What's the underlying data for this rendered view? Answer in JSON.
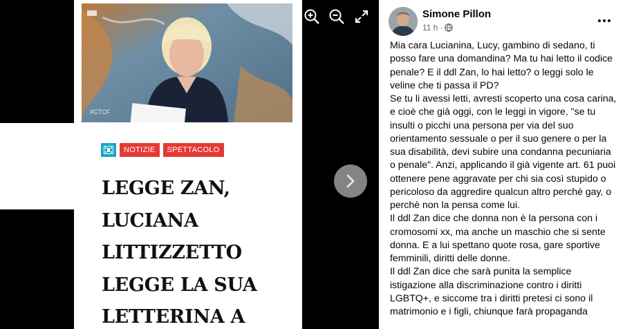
{
  "viewer": {
    "photo_watermark": "#CTCF",
    "tags": [
      "NOTIZIE",
      "SPETTACOLO"
    ],
    "headline_lines": [
      "LEGGE ZAN,",
      "LUCIANA",
      "LITTIZZETTO",
      "LEGGE LA SUA",
      "LETTERINA A"
    ],
    "icons": {
      "zoom_in": "zoom-in-icon",
      "zoom_out": "zoom-out-icon",
      "fullscreen": "fullscreen-icon",
      "next": "chevron-right-icon"
    }
  },
  "post": {
    "author": "Simone Pillon",
    "time": "11 h",
    "separator": "·",
    "privacy_icon": "globe-icon",
    "paragraphs": [
      "Mia cara Lucianina, Lucy, gambino di sedano, ti posso fare una domandina? Ma tu hai letto il codice penale? E il ddl Zan, lo hai letto? o leggi solo le veline che ti passa il PD?",
      "Se tu li avessi letti, avresti scoperto una cosa carina, e cioè che già oggi, con le leggi in vigore, \"se tu insulti o picchi una persona per via del suo orientamento sessuale o per il suo genere o per la sua disabilità, devi subire una condanna pecuniaria o penale\". Anzi, applicando il già vigente art. 61 puoi ottenere pene aggravate per chi sia così stupido o pericoloso da aggredire qualcun altro perchè gay, o perchè non la pensa come lui.",
      "Il ddl Zan dice che donna non è la persona con i cromosomi xx, ma anche un maschio che si sente donna. E a lui spettano quote rosa, gare sportive femminili, diritti delle donne.",
      "Il ddl Zan dice che sarà punita la semplice istigazione alla discriminazione contro i diritti LGBTQ+, e siccome tra i diritti pretesi ci sono il matrimonio e i figli, chiunque farà propaganda"
    ]
  },
  "colors": {
    "tag_red": "#e53935",
    "tag_blue": "#1ba5c4",
    "meta_gray": "#65676b",
    "text": "#050505"
  }
}
